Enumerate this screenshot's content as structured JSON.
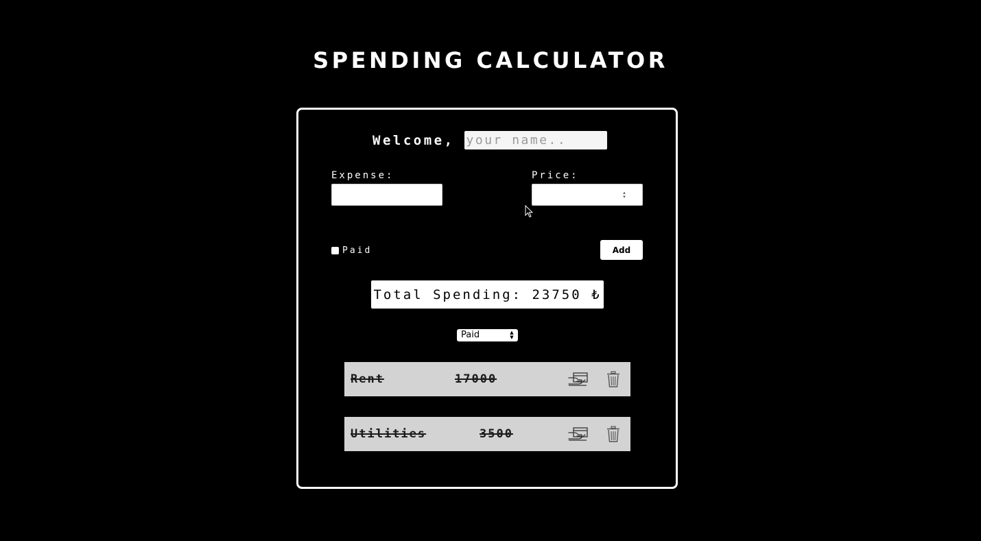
{
  "page": {
    "title": "SPENDING CALCULATOR"
  },
  "welcome": {
    "label": "Welcome,",
    "name_placeholder": "your name..",
    "name_value": ""
  },
  "form": {
    "expense_label": "Expense:",
    "expense_value": "",
    "price_label": "Price:",
    "price_value": "",
    "paid_label": "Paid",
    "paid_checked": false,
    "add_label": "Add"
  },
  "total": {
    "text": "Total Spending: 23750 ₺"
  },
  "filter": {
    "selected": "Paid"
  },
  "expenses": [
    {
      "name": "Rent",
      "price": "17000",
      "paid": true
    },
    {
      "name": "Utilities",
      "price": "3500",
      "paid": true
    }
  ],
  "icons": {
    "pay": "hand-card-icon",
    "delete": "trash-icon"
  },
  "colors": {
    "background": "#000000",
    "foreground": "#ffffff",
    "item_background": "#d3d3d3"
  }
}
